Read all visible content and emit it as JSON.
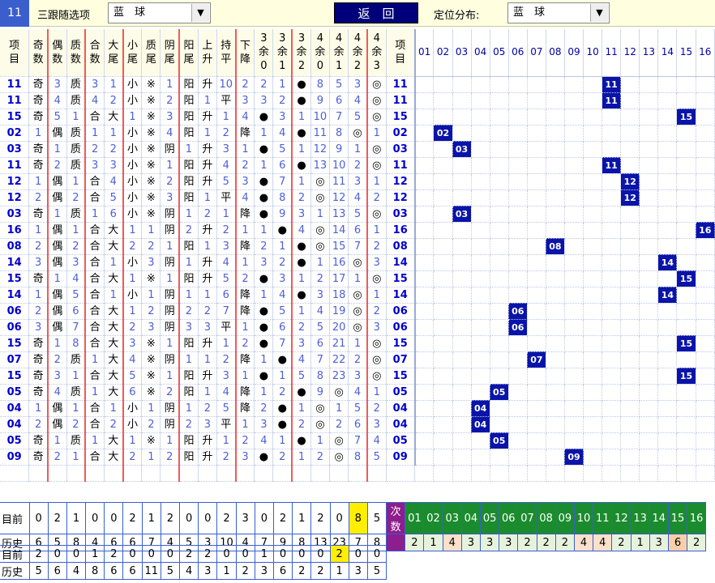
{
  "header": {
    "current": "11",
    "follow_label": "三跟随选项",
    "follow_value": "蓝　球",
    "back": "返　回",
    "dist_label": "定位分布:",
    "dist_value": "蓝　球",
    "arrow": "▼"
  },
  "columns": [
    "项目",
    "奇数",
    "偶数",
    "质数",
    "合数",
    "大尾",
    "小尾",
    "质尾",
    "阴尾",
    "阳尾",
    "上升",
    "持平",
    "下降",
    "3余0",
    "3余1",
    "3余2",
    "4余0",
    "4余1",
    "4余2",
    "4余3",
    "项目"
  ],
  "positions": [
    "01",
    "02",
    "03",
    "04",
    "05",
    "06",
    "07",
    "08",
    "09",
    "10",
    "11",
    "12",
    "13",
    "14",
    "15",
    "16"
  ],
  "rows": [
    {
      "id": "11",
      "c": [
        "奇",
        "3",
        "质",
        "3",
        "1",
        "小",
        "※",
        "1",
        "阳",
        "升",
        "10",
        "2",
        "2",
        "1",
        "●",
        "8",
        "5",
        "3",
        "◎"
      ],
      "hit": 11
    },
    {
      "id": "11",
      "c": [
        "奇",
        "4",
        "质",
        "4",
        "2",
        "小",
        "※",
        "2",
        "阳",
        "1",
        "平",
        "3",
        "3",
        "2",
        "●",
        "9",
        "6",
        "4",
        "◎"
      ],
      "hit": 11
    },
    {
      "id": "15",
      "c": [
        "奇",
        "5",
        "1",
        "合",
        "大",
        "1",
        "※",
        "3",
        "阳",
        "升",
        "1",
        "4",
        "●",
        "3",
        "1",
        "10",
        "7",
        "5",
        "◎"
      ],
      "hit": 15
    },
    {
      "id": "02",
      "c": [
        "1",
        "偶",
        "质",
        "1",
        "1",
        "小",
        "※",
        "4",
        "阳",
        "1",
        "2",
        "降",
        "1",
        "4",
        "●",
        "11",
        "8",
        "◎",
        "1"
      ],
      "hit": 2
    },
    {
      "id": "03",
      "c": [
        "奇",
        "1",
        "质",
        "2",
        "2",
        "小",
        "※",
        "阴",
        "1",
        "升",
        "3",
        "1",
        "●",
        "5",
        "1",
        "12",
        "9",
        "1",
        "◎"
      ],
      "hit": 3
    },
    {
      "id": "11",
      "c": [
        "奇",
        "2",
        "质",
        "3",
        "3",
        "小",
        "※",
        "1",
        "阳",
        "升",
        "4",
        "2",
        "1",
        "6",
        "●",
        "13",
        "10",
        "2",
        "◎"
      ],
      "hit": 11
    },
    {
      "id": "12",
      "c": [
        "1",
        "偶",
        "1",
        "合",
        "4",
        "小",
        "※",
        "2",
        "阳",
        "升",
        "5",
        "3",
        "●",
        "7",
        "1",
        "◎",
        "11",
        "3",
        "1"
      ],
      "hit": 12
    },
    {
      "id": "12",
      "c": [
        "2",
        "偶",
        "2",
        "合",
        "5",
        "小",
        "※",
        "3",
        "阳",
        "1",
        "平",
        "4",
        "●",
        "8",
        "2",
        "◎",
        "12",
        "4",
        "2"
      ],
      "hit": 12
    },
    {
      "id": "03",
      "c": [
        "奇",
        "1",
        "质",
        "1",
        "6",
        "小",
        "※",
        "阴",
        "1",
        "2",
        "1",
        "降",
        "●",
        "9",
        "3",
        "1",
        "13",
        "5",
        "◎"
      ],
      "hit": 3
    },
    {
      "id": "16",
      "c": [
        "1",
        "偶",
        "1",
        "合",
        "大",
        "1",
        "1",
        "阴",
        "2",
        "升",
        "2",
        "1",
        "1",
        "●",
        "4",
        "◎",
        "14",
        "6",
        "1"
      ],
      "hit": 16
    },
    {
      "id": "08",
      "c": [
        "2",
        "偶",
        "2",
        "合",
        "大",
        "2",
        "2",
        "1",
        "阳",
        "1",
        "3",
        "降",
        "2",
        "1",
        "●",
        "◎",
        "15",
        "7",
        "2"
      ],
      "hit": 8
    },
    {
      "id": "14",
      "c": [
        "3",
        "偶",
        "3",
        "合",
        "1",
        "小",
        "3",
        "阴",
        "1",
        "升",
        "4",
        "1",
        "3",
        "2",
        "●",
        "1",
        "16",
        "◎",
        "3"
      ],
      "hit": 14
    },
    {
      "id": "15",
      "c": [
        "奇",
        "1",
        "4",
        "合",
        "大",
        "1",
        "※",
        "1",
        "阳",
        "升",
        "5",
        "2",
        "●",
        "3",
        "1",
        "2",
        "17",
        "1",
        "◎"
      ],
      "hit": 15
    },
    {
      "id": "14",
      "c": [
        "1",
        "偶",
        "5",
        "合",
        "1",
        "小",
        "1",
        "阴",
        "1",
        "1",
        "6",
        "降",
        "1",
        "4",
        "●",
        "3",
        "18",
        "◎",
        "1"
      ],
      "hit": 14
    },
    {
      "id": "06",
      "c": [
        "2",
        "偶",
        "6",
        "合",
        "大",
        "1",
        "2",
        "阴",
        "2",
        "2",
        "7",
        "降",
        "●",
        "5",
        "1",
        "4",
        "19",
        "◎",
        "2"
      ],
      "hit": 6
    },
    {
      "id": "06",
      "c": [
        "3",
        "偶",
        "7",
        "合",
        "大",
        "2",
        "3",
        "阴",
        "3",
        "3",
        "平",
        "1",
        "●",
        "6",
        "2",
        "5",
        "20",
        "◎",
        "3"
      ],
      "hit": 6
    },
    {
      "id": "15",
      "c": [
        "奇",
        "1",
        "8",
        "合",
        "大",
        "3",
        "※",
        "1",
        "阳",
        "升",
        "1",
        "2",
        "●",
        "7",
        "3",
        "6",
        "21",
        "1",
        "◎"
      ],
      "hit": 15
    },
    {
      "id": "07",
      "c": [
        "奇",
        "2",
        "质",
        "1",
        "大",
        "4",
        "※",
        "阴",
        "1",
        "1",
        "2",
        "降",
        "1",
        "●",
        "4",
        "7",
        "22",
        "2",
        "◎"
      ],
      "hit": 7
    },
    {
      "id": "15",
      "c": [
        "奇",
        "3",
        "1",
        "合",
        "大",
        "5",
        "※",
        "1",
        "阳",
        "升",
        "3",
        "1",
        "●",
        "1",
        "5",
        "8",
        "23",
        "3",
        "◎"
      ],
      "hit": 15
    },
    {
      "id": "05",
      "c": [
        "奇",
        "4",
        "质",
        "1",
        "大",
        "6",
        "※",
        "2",
        "阳",
        "1",
        "4",
        "降",
        "1",
        "2",
        "●",
        "9",
        "◎",
        "4",
        "1"
      ],
      "hit": 5
    },
    {
      "id": "04",
      "c": [
        "1",
        "偶",
        "1",
        "合",
        "1",
        "小",
        "1",
        "阴",
        "1",
        "2",
        "5",
        "降",
        "2",
        "●",
        "1",
        "◎",
        "1",
        "5",
        "2"
      ],
      "hit": 4
    },
    {
      "id": "04",
      "c": [
        "2",
        "偶",
        "2",
        "合",
        "2",
        "小",
        "2",
        "阴",
        "2",
        "3",
        "平",
        "1",
        "3",
        "●",
        "2",
        "◎",
        "2",
        "6",
        "3"
      ],
      "hit": 4
    },
    {
      "id": "05",
      "c": [
        "奇",
        "1",
        "质",
        "1",
        "大",
        "1",
        "※",
        "1",
        "阳",
        "升",
        "1",
        "2",
        "4",
        "1",
        "●",
        "1",
        "◎",
        "7",
        "4"
      ],
      "hit": 5
    },
    {
      "id": "09",
      "c": [
        "奇",
        "2",
        "1",
        "合",
        "大",
        "2",
        "1",
        "2",
        "阳",
        "升",
        "2",
        "3",
        "●",
        "2",
        "1",
        "2",
        "◎",
        "8",
        "5"
      ],
      "hit": 9
    }
  ],
  "stats1": {
    "cur_label": "目前",
    "hist_label": "历史",
    "current": [
      "0",
      "2",
      "1",
      "0",
      "0",
      "2",
      "1",
      "2",
      "0",
      "0",
      "2",
      "3",
      "0",
      "2",
      "1",
      "2",
      "0",
      "8",
      "5"
    ],
    "history": [
      "6",
      "5",
      "8",
      "4",
      "6",
      "6",
      "7",
      "4",
      "5",
      "3",
      "10",
      "4",
      "7",
      "9",
      "8",
      "13",
      "23",
      "7",
      "8"
    ]
  },
  "counts": {
    "label": "次数",
    "positions": [
      "01",
      "02",
      "03",
      "04",
      "05",
      "06",
      "07",
      "08",
      "09",
      "10",
      "11",
      "12",
      "13",
      "14",
      "15",
      "16"
    ],
    "values": [
      "2",
      "1",
      "4",
      "3",
      "3",
      "3",
      "2",
      "2",
      "2",
      "4",
      "4",
      "2",
      "1",
      "3",
      "6",
      "2"
    ]
  },
  "stats2": {
    "cur_label": "目前",
    "hist_label": "历史",
    "current": [
      "2",
      "0",
      "0",
      "1",
      "2",
      "0",
      "0",
      "0",
      "2",
      "2",
      "0",
      "0",
      "1",
      "0",
      "0",
      "0",
      "2",
      "0",
      "0"
    ],
    "history": [
      "5",
      "6",
      "4",
      "8",
      "6",
      "6",
      "11",
      "5",
      "4",
      "3",
      "1",
      "2",
      "3",
      "6",
      "2",
      "2",
      "1",
      "3",
      "5"
    ]
  }
}
